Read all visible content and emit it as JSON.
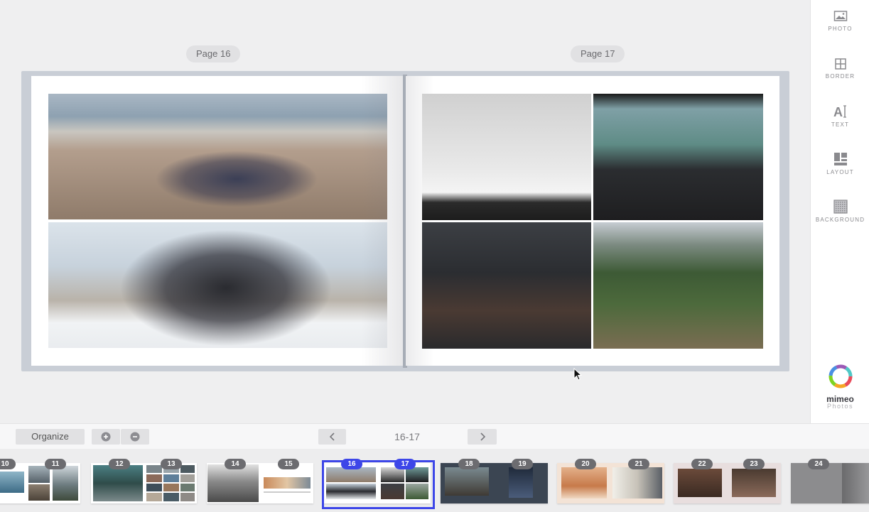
{
  "spread": {
    "left_label": "Page 16",
    "right_label": "Page 17"
  },
  "sidebar": {
    "tools": [
      {
        "label": "PHOTO",
        "icon": "photo-icon"
      },
      {
        "label": "BORDER",
        "icon": "border-icon"
      },
      {
        "label": "TEXT",
        "icon": "text-icon"
      },
      {
        "label": "LAYOUT",
        "icon": "layout-icon"
      },
      {
        "label": "BACKGROUND",
        "icon": "background-icon"
      }
    ],
    "brand": {
      "name": "mimeo",
      "sub": "Photos"
    }
  },
  "toolbar": {
    "organize_label": "Organize",
    "zoom_in_icon": "plus-circle-icon",
    "zoom_out_icon": "minus-circle-icon",
    "page_range": "16-17",
    "prev_icon": "chevron-left-icon",
    "next_icon": "chevron-right-icon"
  },
  "thumbnails": [
    {
      "pages": [
        "10",
        "11"
      ]
    },
    {
      "pages": [
        "12",
        "13"
      ]
    },
    {
      "pages": [
        "14",
        "15"
      ]
    },
    {
      "pages": [
        "16",
        "17"
      ],
      "selected": true
    },
    {
      "pages": [
        "18",
        "19"
      ]
    },
    {
      "pages": [
        "20",
        "21"
      ]
    },
    {
      "pages": [
        "22",
        "23"
      ]
    },
    {
      "pages": [
        "24"
      ]
    }
  ],
  "colors": {
    "accent": "#3d46e8",
    "badge": "#6c6c70"
  }
}
